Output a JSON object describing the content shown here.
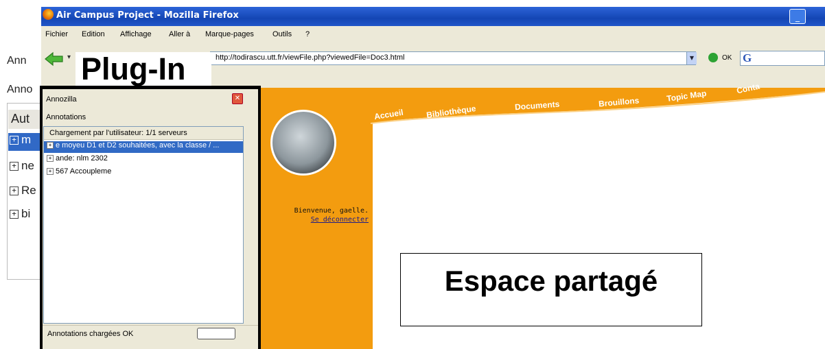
{
  "window": {
    "title": "Air Campus Project - Mozilla Firefox"
  },
  "background_window": {
    "tab_top": "Ann",
    "tab_second": "Anno",
    "header": "Aut",
    "rows": [
      "m",
      "ne",
      "Re",
      "bi"
    ]
  },
  "menu": {
    "items": [
      "Fichier",
      "Edition",
      "Affichage",
      "Aller à",
      "Marque-pages",
      "Outils",
      "?"
    ]
  },
  "navigation": {
    "url": "http://todirascu.utt.fr/viewFile.php?viewedFile=Doc3.html",
    "go_label": "OK"
  },
  "callouts": {
    "plugin": "Plug-In",
    "shared_space": "Espace partagé"
  },
  "sidebar": {
    "title": "Annozilla",
    "subtitle": "Annotations",
    "loading": "Chargement par l'utilisateur: 1/1 serveurs",
    "items": [
      "e moyeu D1 et D2 souhaitées, avec la classe / ...",
      "ande: nlm 2302",
      "567 Accoupleme"
    ],
    "status": "Annotations chargées OK"
  },
  "webpage": {
    "nav": [
      "Accueil",
      "Bibliothèque",
      "Documents",
      "Brouillons",
      "Topic Map",
      "Conta"
    ],
    "welcome": "Bienvenue, gaelle.",
    "logout": "Se déconnecter",
    "colors": {
      "orange": "#f39c0f",
      "selection": "#316ac5",
      "titlebar": "#1446b4"
    }
  }
}
